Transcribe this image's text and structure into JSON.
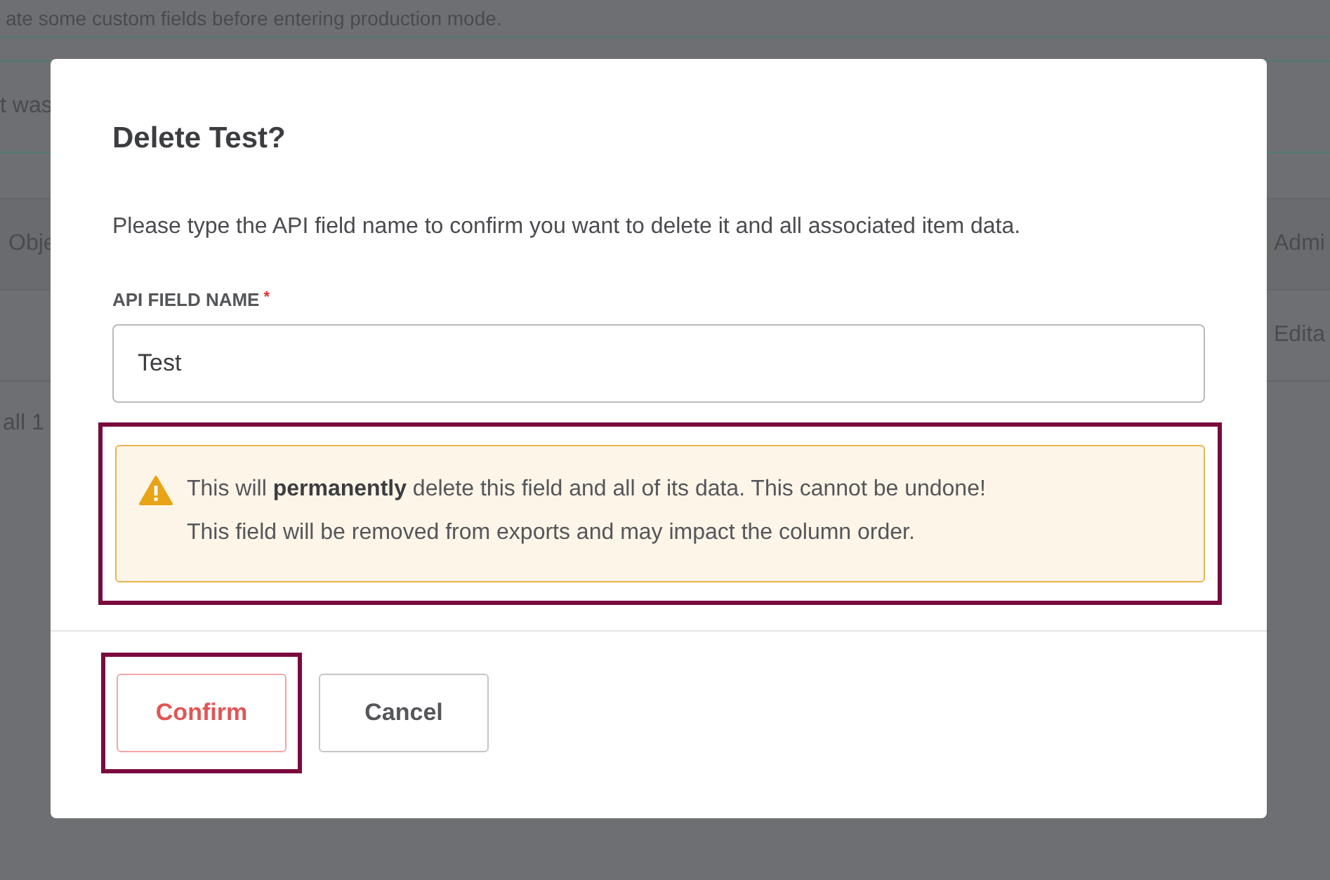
{
  "background": {
    "banner_text": "ate some custom fields before entering production mode.",
    "notice_text": "t was",
    "table": {
      "header": [
        "Obje",
        "Admi"
      ],
      "row": [
        "Edita"
      ],
      "footer": "all 1"
    }
  },
  "dialog": {
    "title": "Delete Test?",
    "description": "Please type the API field name to confirm you want to delete it and all associated item data.",
    "field": {
      "label": "API FIELD NAME",
      "required_mark": "*",
      "value": "Test"
    },
    "warning": {
      "annotation_frame": true,
      "lines": [
        "This will **permanently** delete this field and all of its data. This cannot be undone!",
        "This field will be removed from exports and may impact the column order."
      ]
    },
    "buttons": [
      {
        "kind": "danger",
        "label": "Confirm",
        "annotation_frame": true
      },
      {
        "kind": "secondary",
        "label": "Cancel",
        "annotation_frame": false
      }
    ]
  }
}
